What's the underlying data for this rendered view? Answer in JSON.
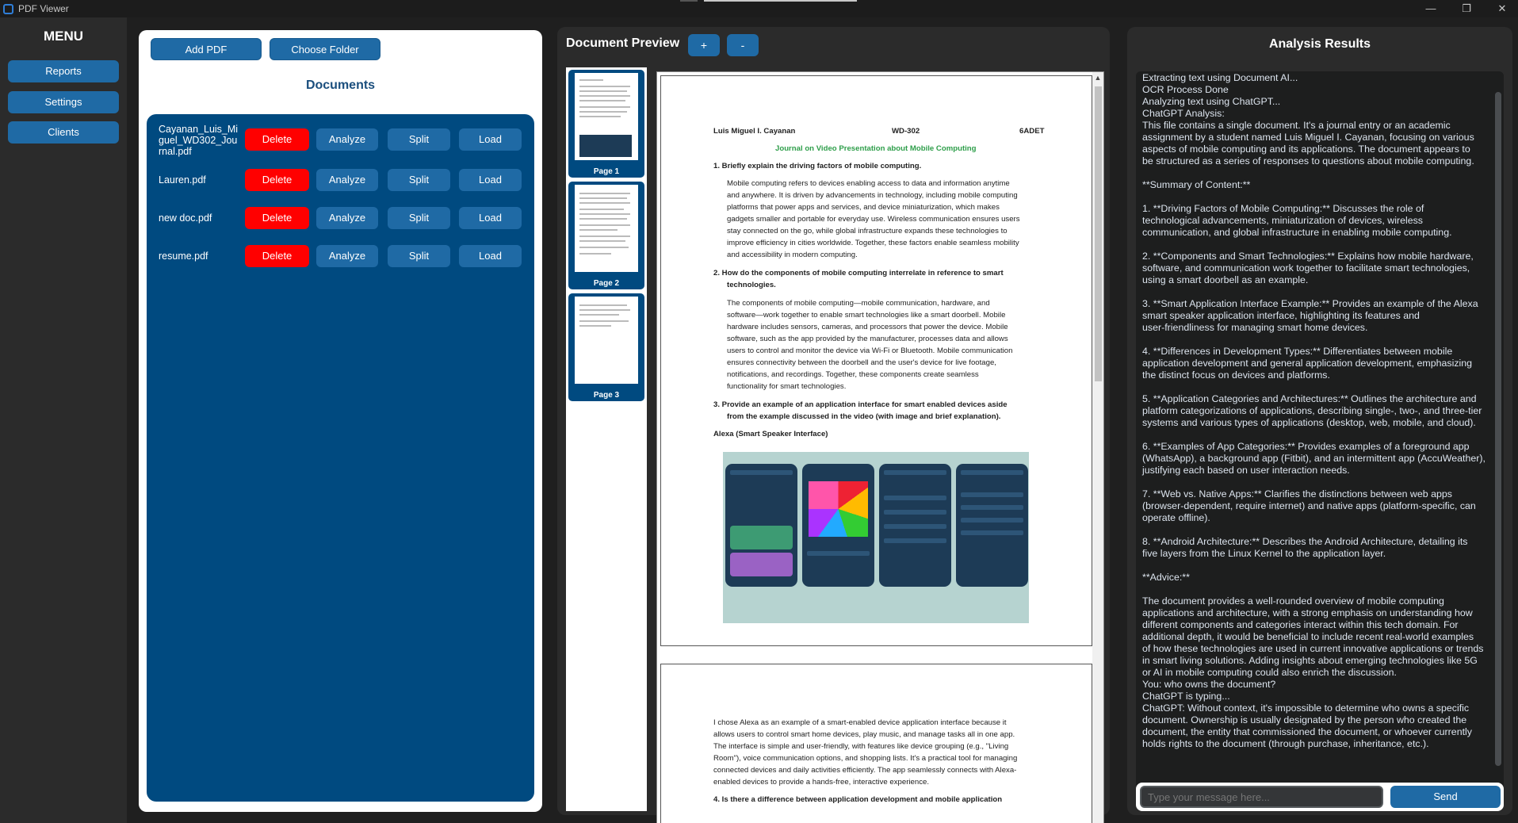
{
  "window": {
    "title": "PDF Viewer",
    "controls": {
      "minimize": "—",
      "restore": "❐",
      "close": "✕"
    }
  },
  "sidebar": {
    "title": "MENU",
    "items": [
      {
        "label": "Reports"
      },
      {
        "label": "Settings"
      },
      {
        "label": "Clients"
      }
    ]
  },
  "documents": {
    "add_pdf_label": "Add PDF",
    "choose_folder_label": "Choose Folder",
    "title": "Documents",
    "files": [
      {
        "name": "Cayanan_Luis_Miguel_WD302_Journal.pdf"
      },
      {
        "name": "Lauren.pdf"
      },
      {
        "name": "new doc.pdf"
      },
      {
        "name": "resume.pdf"
      }
    ],
    "actions": {
      "delete": "Delete",
      "analyze": "Analyze",
      "split": "Split",
      "load": "Load"
    }
  },
  "preview": {
    "title": "Document Preview",
    "zoom_in": "+",
    "zoom_out": "-",
    "pages": [
      {
        "label": "Page 1"
      },
      {
        "label": "Page 2"
      },
      {
        "label": "Page 3"
      }
    ],
    "page1": {
      "author": "Luis Miguel I. Cayanan",
      "course": "WD-302",
      "section": "6ADET",
      "heading": "Journal on Video Presentation about Mobile Computing",
      "q1": "1.   Briefly explain the driving factors of mobile computing.",
      "a1": [
        "Mobile computing refers to devices enabling access to data and information anytime",
        "and anywhere. It is driven by advancements in technology, including mobile computing",
        "platforms that power apps and services, and device miniaturization, which makes",
        "gadgets smaller and portable for everyday use. Wireless communication ensures users",
        "stay connected on the go, while global infrastructure expands these technologies to",
        "improve efficiency in cities worldwide. Together, these factors enable seamless mobility",
        "and accessibility in modern computing."
      ],
      "q2a": "2.   How do the components of mobile computing interrelate in reference to smart",
      "q2b": "technologies.",
      "a2": [
        "The components of mobile computing—mobile communication, hardware, and",
        "software—work together to enable smart technologies like a smart doorbell. Mobile",
        "hardware includes sensors, cameras, and processors that power the device. Mobile",
        "software, such as the app provided by the manufacturer, processes data and allows",
        "users to control and monitor the device via Wi-Fi or Bluetooth. Mobile communication",
        "ensures connectivity between the doorbell and the user's device for live footage,",
        "notifications, and recordings. Together, these components create seamless",
        "functionality for smart technologies."
      ],
      "q3a": "3.   Provide an example of an application interface for smart enabled devices aside",
      "q3b": "from the example discussed in the video (with image and brief explanation).",
      "figure_caption": "Alexa (Smart Speaker Interface)"
    },
    "page2": {
      "lines": [
        "I chose Alexa as an example of a smart-enabled device application interface because it",
        "allows users to control smart home devices, play music, and manage tasks all in one app.",
        "The interface is simple and user-friendly, with features like device grouping (e.g., \"Living",
        "Room\"), voice communication options, and shopping lists. It's a practical tool for managing",
        "connected devices and daily activities efficiently. The app seamlessly connects with Alexa-",
        "enabled devices to provide a hands-free, interactive experience."
      ],
      "q4": "4.   Is there a difference between application development and mobile application"
    }
  },
  "analysis": {
    "title": "Analysis Results",
    "text": "Extracting text using Document AI...\nOCR Process Done\nAnalyzing text using ChatGPT...\nChatGPT Analysis:\nThis file contains a single document. It's a journal entry or an academic\nassignment by a student named Luis Miguel I. Cayanan, focusing on various\naspects of mobile computing and its applications. The document appears to\nbe structured as a series of responses to questions about mobile computing.\n\n**Summary of Content:**\n\n1. **Driving Factors of Mobile Computing:** Discusses the role of\ntechnological advancements, miniaturization of devices, wireless\ncommunication, and global infrastructure in enabling mobile computing.\n\n2. **Components and Smart Technologies:** Explains how mobile hardware,\nsoftware, and communication work together to facilitate smart technologies,\nusing a smart doorbell as an example.\n\n3. **Smart Application Interface Example:** Provides an example of the Alexa\nsmart speaker application interface, highlighting its features and\nuser-friendliness for managing smart home devices.\n\n4. **Differences in Development Types:** Differentiates between mobile\napplication development and general application development, emphasizing\nthe distinct focus on devices and platforms.\n\n5. **Application Categories and Architectures:** Outlines the architecture and\nplatform categorizations of applications, describing single-, two-, and three-tier\nsystems and various types of applications (desktop, web, mobile, and cloud).\n\n6. **Examples of App Categories:** Provides examples of a foreground app\n(WhatsApp), a background app (Fitbit), and an intermittent app (AccuWeather),\njustifying each based on user interaction needs.\n\n7. **Web vs. Native Apps:** Clarifies the distinctions between web apps\n(browser-dependent, require internet) and native apps (platform-specific, can\noperate offline).\n\n8. **Android Architecture:** Describes the Android Architecture, detailing its\nfive layers from the Linux Kernel to the application layer.\n\n**Advice:**\n\nThe document provides a well-rounded overview of mobile computing\napplications and architecture, with a strong emphasis on understanding how\ndifferent components and categories interact within this tech domain. For\nadditional depth, it would be beneficial to include recent real-world examples\nof how these technologies are used in current innovative applications or trends\nin smart living solutions. Adding insights about emerging technologies like 5G\nor AI in mobile computing could also enrich the discussion.\nYou: who owns the document?\nChatGPT is typing...\nChatGPT: Without context, it's impossible to determine who owns a specific\ndocument. Ownership is usually designated by the person who created the\ndocument, the entity that commissioned the document, or whoever currently\nholds rights to the document (through purchase, inheritance, etc.).",
    "input_placeholder": "Type your message here...",
    "send_label": "Send"
  },
  "colors": {
    "accent": "#1f6aa5",
    "delete": "#ff0000",
    "doc_list_bg": "#004a80"
  }
}
